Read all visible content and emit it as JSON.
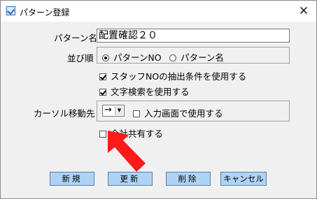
{
  "window": {
    "title": "パターン登録",
    "close_glyph": "✕"
  },
  "form": {
    "pattern_name_label": "パターン名",
    "pattern_name_value": "配置確認２０",
    "sort_label": "並び順",
    "sort_options": [
      {
        "label": "パターンNO",
        "selected": true
      },
      {
        "label": "パターン名",
        "selected": false
      }
    ],
    "staff_filter_label": "スタッフNOの抽出条件を使用する",
    "staff_filter_checked": true,
    "text_search_label": "文字検索を使用する",
    "text_search_checked": true,
    "cursor_label": "カーソル移動先",
    "cursor_value": "→",
    "input_screen_label": "入力画面で使用する",
    "input_screen_checked": false,
    "shared_label": "全社共有する",
    "shared_checked": false
  },
  "buttons": {
    "new": "新規",
    "update": "更新",
    "delete": "削除",
    "cancel": "キャンセル"
  },
  "colors": {
    "button_bg": "#aed3f5",
    "annotation_arrow": "#ff1a1a"
  },
  "icons": {
    "app": "checkmark-window-icon",
    "close": "close-icon",
    "dropdown": "triangle-down-icon",
    "annotation": "red-pointer-arrow"
  }
}
